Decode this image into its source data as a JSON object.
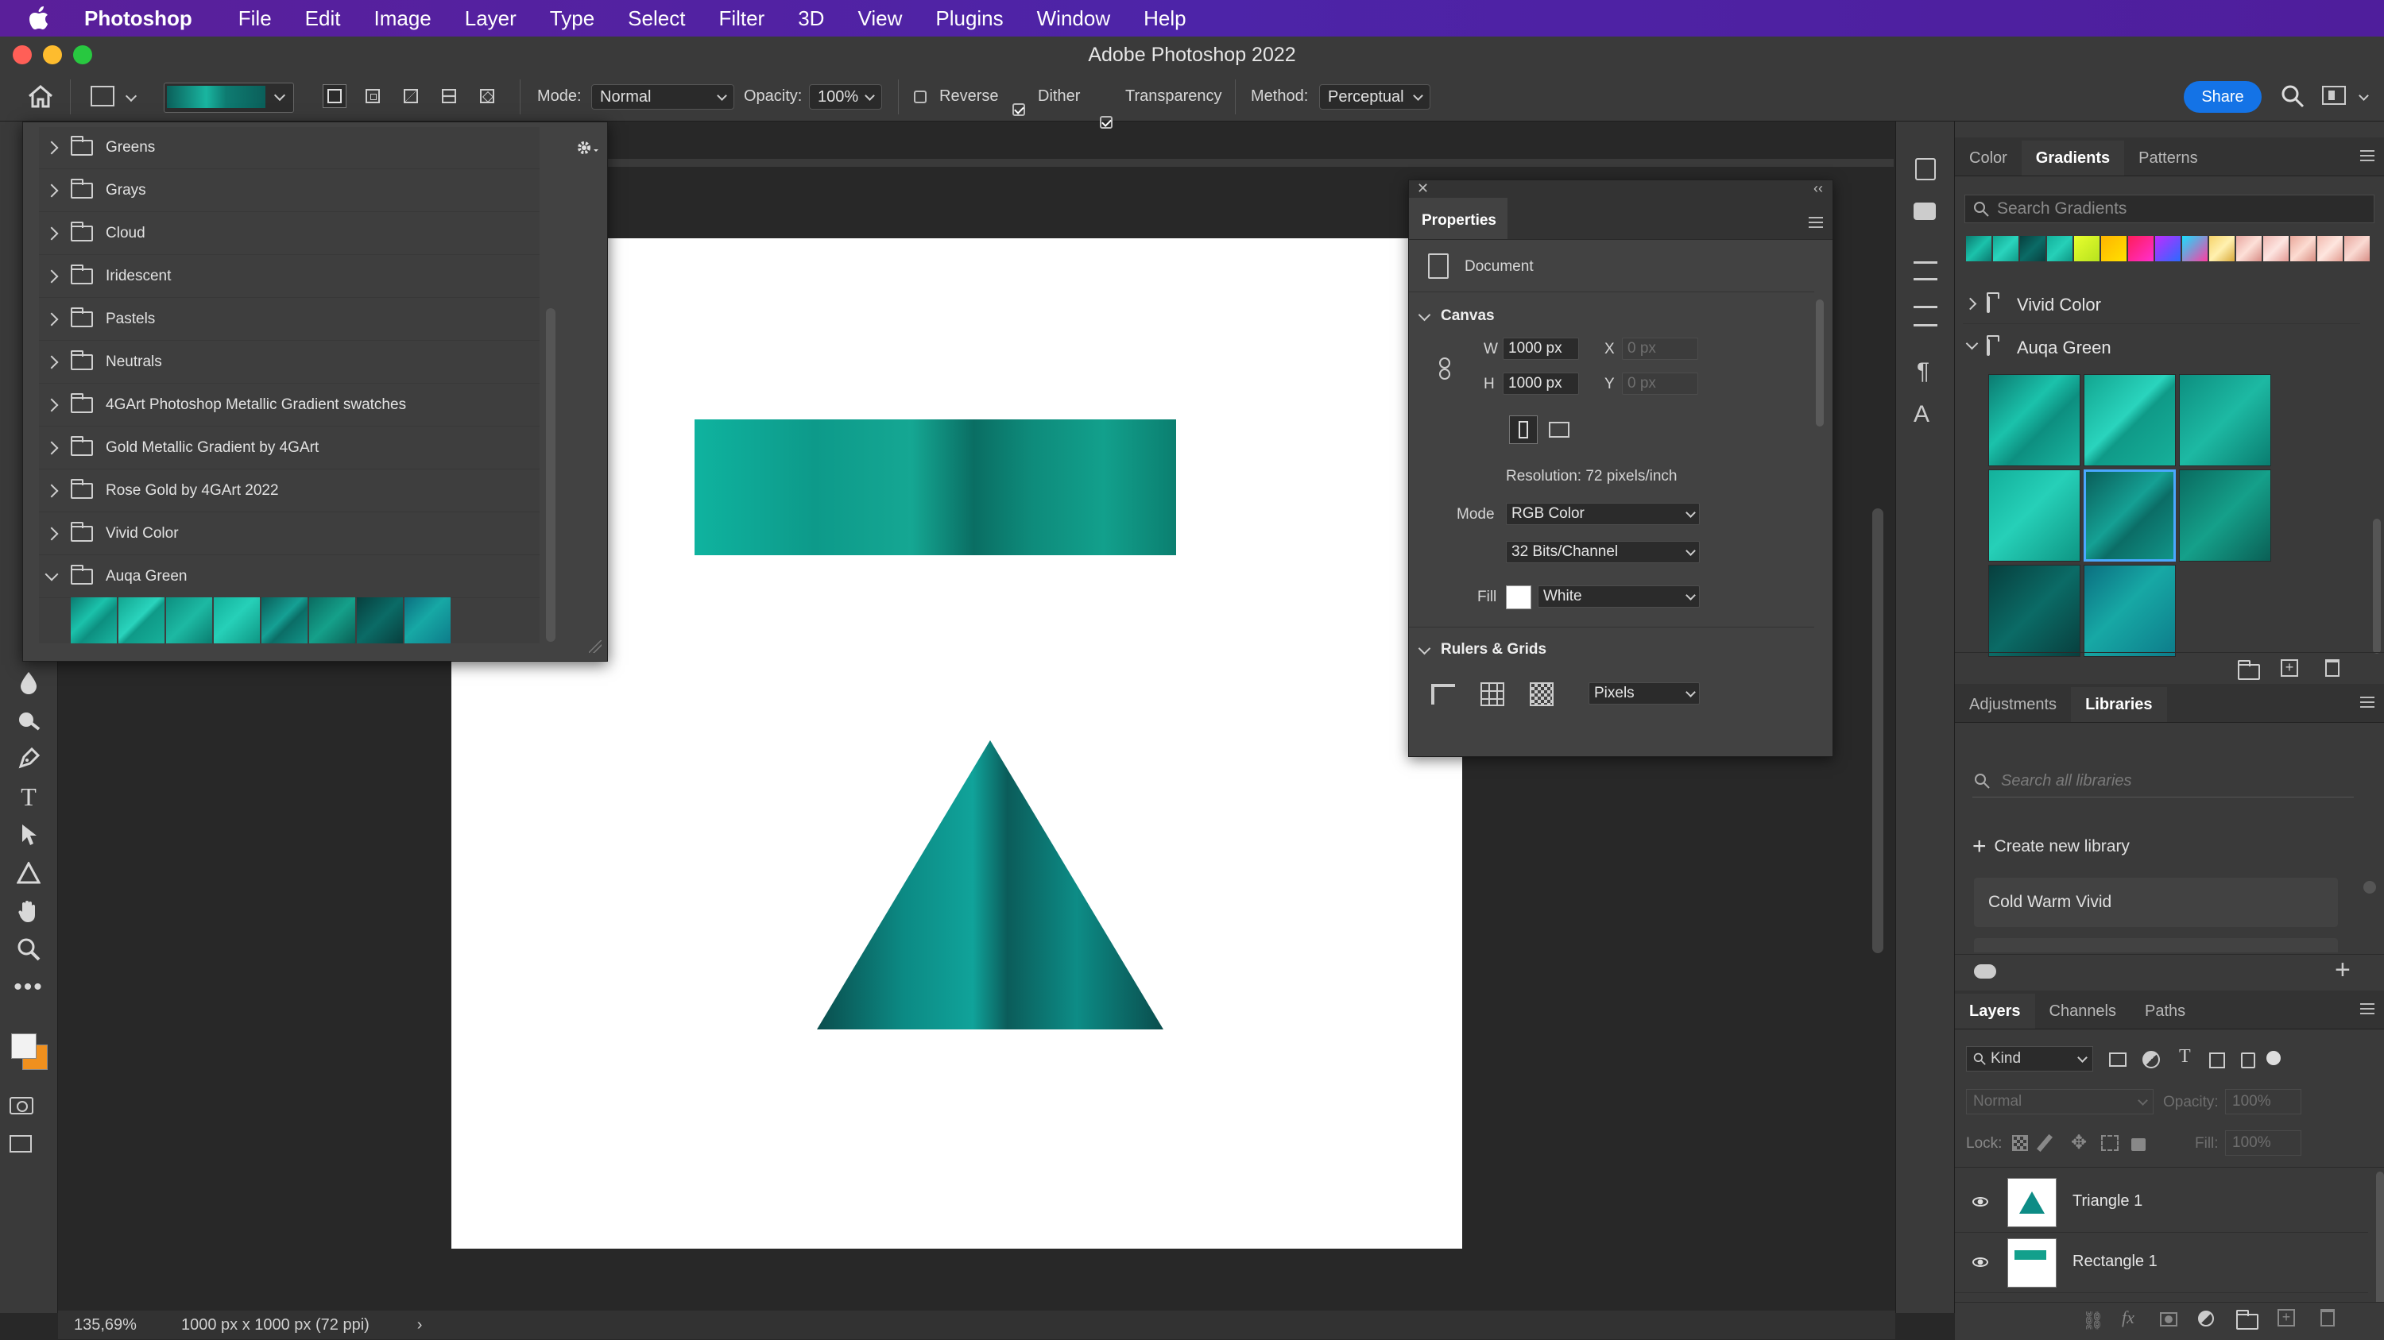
{
  "menubar": {
    "app": "Photoshop",
    "items": [
      "File",
      "Edit",
      "Image",
      "Layer",
      "Type",
      "Select",
      "Filter",
      "3D",
      "View",
      "Plugins",
      "Window",
      "Help"
    ]
  },
  "window": {
    "title": "Adobe Photoshop 2022"
  },
  "options": {
    "mode_label": "Mode:",
    "mode_value": "Normal",
    "opacity_label": "Opacity:",
    "opacity_value": "100%",
    "reverse_label": "Reverse",
    "reverse_checked": false,
    "dither_label": "Dither",
    "dither_checked": true,
    "transparency_label": "Transparency",
    "transparency_checked": true,
    "method_label": "Method:",
    "method_value": "Perceptual",
    "share_label": "Share"
  },
  "gradient_picker": {
    "folders": [
      {
        "name": "Greens",
        "open": false
      },
      {
        "name": "Grays",
        "open": false
      },
      {
        "name": "Cloud",
        "open": false
      },
      {
        "name": "Iridescent",
        "open": false
      },
      {
        "name": "Pastels",
        "open": false
      },
      {
        "name": "Neutrals",
        "open": false
      },
      {
        "name": "4GArt Photoshop Metallic Gradient swatches",
        "open": false
      },
      {
        "name": "Gold Metallic Gradient by 4GArt",
        "open": false
      },
      {
        "name": "Rose Gold by 4GArt 2022",
        "open": false
      },
      {
        "name": "Vivid Color",
        "open": false
      },
      {
        "name": "Auqa Green",
        "open": true
      }
    ],
    "open_swatch_count": 8
  },
  "properties": {
    "tab": "Properties",
    "doc_label": "Document",
    "canvas_section": "Canvas",
    "w_label": "W",
    "w_value": "1000 px",
    "h_label": "H",
    "h_value": "1000 px",
    "x_label": "X",
    "x_value": "0 px",
    "y_label": "Y",
    "y_value": "0 px",
    "resolution": "Resolution: 72 pixels/inch",
    "mode_label": "Mode",
    "mode_value": "RGB Color",
    "bits_value": "32 Bits/Channel",
    "fill_label": "Fill",
    "fill_value": "White",
    "rulers_section": "Rulers & Grids",
    "units_value": "Pixels"
  },
  "gradients_panel": {
    "tabs": [
      "Color",
      "Gradients",
      "Patterns"
    ],
    "active_tab": "Gradients",
    "search_placeholder": "Search Gradients",
    "groups": [
      {
        "name": "Vivid Color",
        "open": false
      },
      {
        "name": "Auqa Green",
        "open": true
      }
    ]
  },
  "libraries_panel": {
    "tabs": [
      "Adjustments",
      "Libraries"
    ],
    "active_tab": "Libraries",
    "search_placeholder": "Search all libraries",
    "create_label": "Create new library",
    "library_item": "Cold Warm Vivid"
  },
  "layers_panel": {
    "tabs": [
      "Layers",
      "Channels",
      "Paths"
    ],
    "active_tab": "Layers",
    "kind_label": "Kind",
    "blend_mode": "Normal",
    "opacity_label": "Opacity:",
    "opacity_value": "100%",
    "lock_label": "Lock:",
    "fill_label": "Fill:",
    "fill_value": "100%",
    "layers": [
      {
        "name": "Triangle 1",
        "visible": true
      },
      {
        "name": "Rectangle 1",
        "visible": true
      }
    ]
  },
  "status": {
    "zoom": "135,69%",
    "doc_info": "1000 px x 1000 px (72 ppi)"
  },
  "colors": {
    "accent": "#1473e6",
    "teal_light": "#19b5a0",
    "teal_dark": "#0b5f5a",
    "foreground_swatch": "#f2f2f2",
    "background_swatch": "#f0901e"
  }
}
